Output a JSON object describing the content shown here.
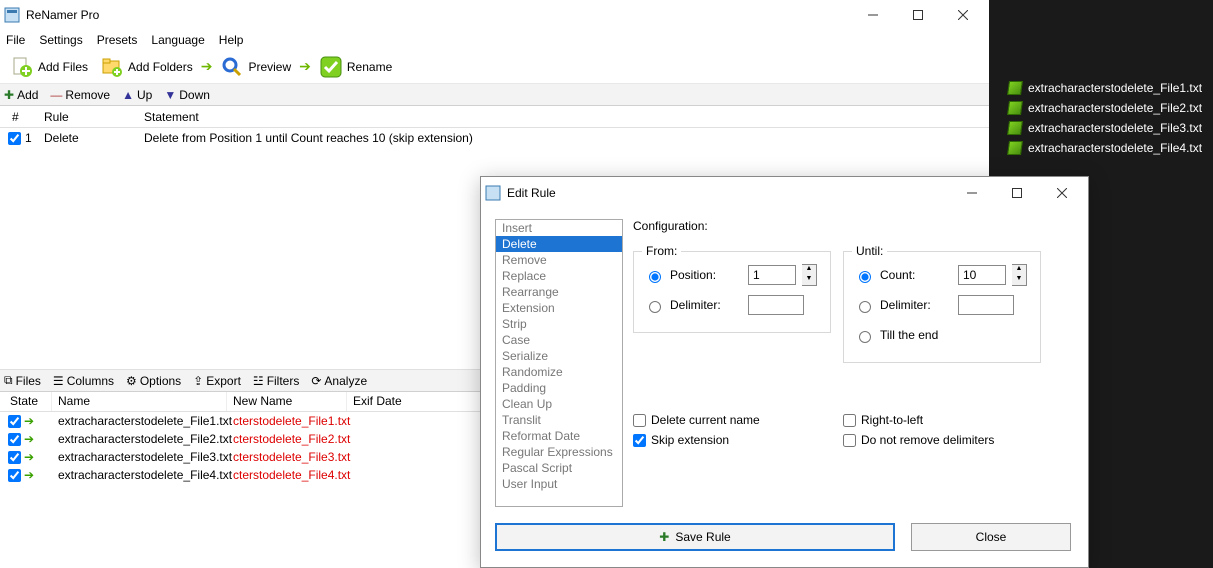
{
  "app": {
    "title": "ReNamer Pro"
  },
  "menu": {
    "file": "File",
    "settings": "Settings",
    "presets": "Presets",
    "language": "Language",
    "help": "Help"
  },
  "toolbar": {
    "addFiles": "Add Files",
    "addFolders": "Add Folders",
    "preview": "Preview",
    "rename": "Rename"
  },
  "subbar": {
    "add": "Add",
    "remove": "Remove",
    "up": "Up",
    "down": "Down"
  },
  "rulesHeader": {
    "num": "#",
    "rule": "Rule",
    "statement": "Statement"
  },
  "rules": [
    {
      "num": "1",
      "rule": "Delete",
      "statement": "Delete from Position 1 until Count reaches 10 (skip extension)"
    }
  ],
  "midbar": {
    "files": "Files",
    "columns": "Columns",
    "options": "Options",
    "export": "Export",
    "filters": "Filters",
    "analyze": "Analyze"
  },
  "filesHeader": {
    "state": "State",
    "name": "Name",
    "newName": "New Name",
    "exif": "Exif Date"
  },
  "files": [
    {
      "name": "extracharacterstodelete_File1.txt",
      "newName": "cterstodelete_File1.txt"
    },
    {
      "name": "extracharacterstodelete_File2.txt",
      "newName": "cterstodelete_File2.txt"
    },
    {
      "name": "extracharacterstodelete_File3.txt",
      "newName": "cterstodelete_File3.txt"
    },
    {
      "name": "extracharacterstodelete_File4.txt",
      "newName": "cterstodelete_File4.txt"
    }
  ],
  "desktopFiles": [
    "extracharacterstodelete_File1.txt",
    "extracharacterstodelete_File2.txt",
    "extracharacterstodelete_File3.txt",
    "extracharacterstodelete_File4.txt"
  ],
  "dialog": {
    "title": "Edit Rule",
    "list": [
      "Insert",
      "Delete",
      "Remove",
      "Replace",
      "Rearrange",
      "Extension",
      "Strip",
      "Case",
      "Serialize",
      "Randomize",
      "Padding",
      "Clean Up",
      "Translit",
      "Reformat Date",
      "Regular Expressions",
      "Pascal Script",
      "User Input"
    ],
    "selected": "Delete",
    "configuration": "Configuration:",
    "from": {
      "label": "From:",
      "position": "Position:",
      "delimiter": "Delimiter:",
      "posValue": "1",
      "delimValue": ""
    },
    "until": {
      "label": "Until:",
      "count": "Count:",
      "delimiter": "Delimiter:",
      "tillEnd": "Till the end",
      "countValue": "10",
      "delimValue": ""
    },
    "checks": {
      "deleteCurrent": "Delete current name",
      "skipExt": "Skip extension",
      "rtl": "Right-to-left",
      "noRemoveDelim": "Do not remove delimiters"
    },
    "save": "Save Rule",
    "close": "Close"
  }
}
